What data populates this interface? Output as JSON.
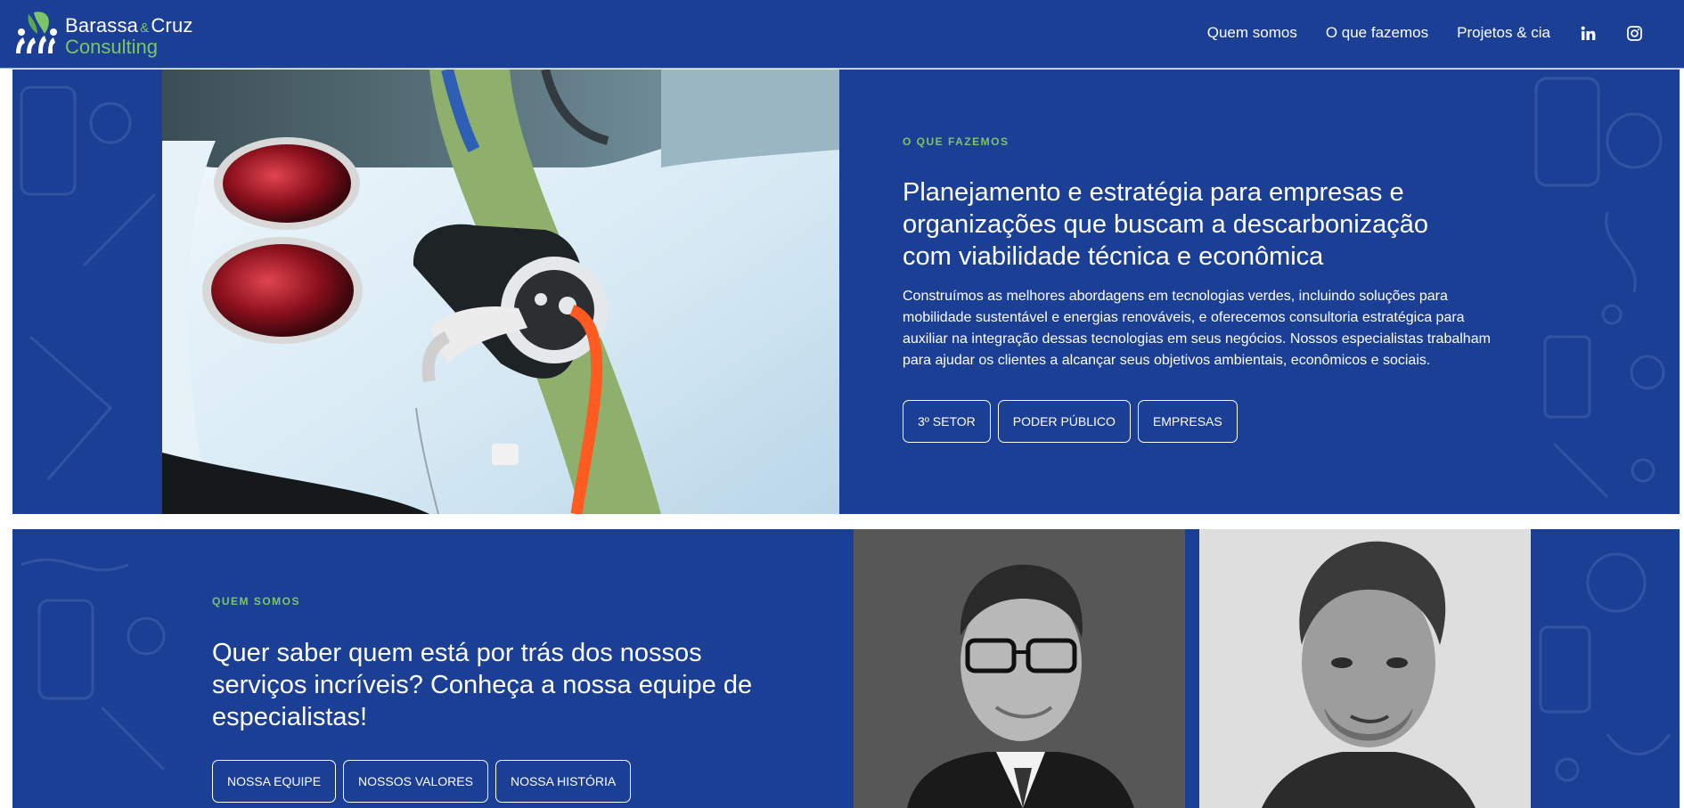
{
  "header": {
    "logo": {
      "line1a": "Barassa",
      "amp": "&",
      "line1b": "Cruz",
      "line2": "Consulting"
    },
    "nav": [
      {
        "label": "Quem somos"
      },
      {
        "label": "O que fazemos"
      },
      {
        "label": "Projetos & cia"
      }
    ],
    "social": [
      "linkedin-icon",
      "instagram-icon"
    ]
  },
  "what_we_do": {
    "eyebrow": "O QUE FAZEMOS",
    "heading": "Planejamento e estratégia para empresas e organizações que buscam a descarbonização com viabilidade técnica e econômica",
    "body": "Construímos as melhores abordagens em tecnologias verdes, incluindo soluções para mobilidade sustentável e energias renováveis, e oferecemos consultoria estratégica para auxiliar na integração dessas tecnologias em seus negócios. Nossos especialistas trabalham para ajudar os clientes a alcançar seus objetivos ambientais, econômicos e sociais.",
    "buttons": [
      "3º SETOR",
      "PODER PÚBLICO",
      "EMPRESAS"
    ]
  },
  "who_we_are": {
    "eyebrow": "QUEM SOMOS",
    "heading": "Quer saber quem está por trás dos nossos serviços incríveis? Conheça a nossa equipe de especialistas!",
    "buttons": [
      "NOSSA EQUIPE",
      "NOSSOS VALORES",
      "NOSSA HISTÓRIA"
    ]
  },
  "colors": {
    "brand_blue": "#1b3f94",
    "brand_green": "#7cc46a",
    "charger_cable": "#ff5a1f"
  }
}
